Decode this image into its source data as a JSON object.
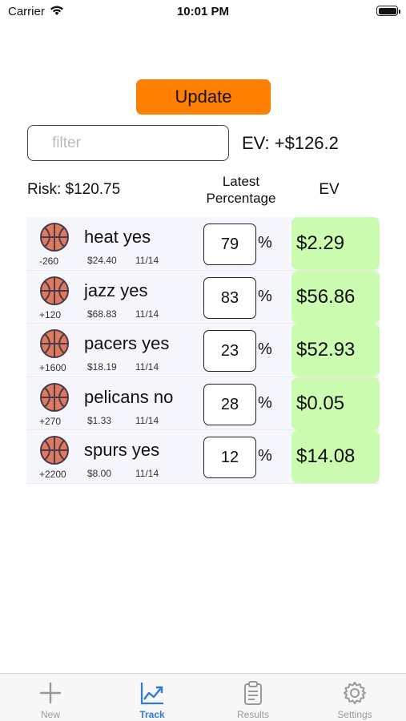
{
  "status_bar": {
    "carrier": "Carrier",
    "time": "10:01 PM"
  },
  "update_label": "Update",
  "filter": {
    "placeholder": "filter",
    "value": ""
  },
  "ev_total": "EV: +$126.2",
  "risk": "Risk: $120.75",
  "columns": {
    "latest_line1": "Latest",
    "latest_line2": "Percentage",
    "ev": "EV"
  },
  "percent_sign": "%",
  "bets": [
    {
      "name": "heat yes",
      "odds": "-260",
      "stake": "$24.40",
      "date": "11/14",
      "percentage": "79",
      "ev": "$2.29"
    },
    {
      "name": "jazz yes",
      "odds": "+120",
      "stake": "$68.83",
      "date": "11/14",
      "percentage": "83",
      "ev": "$56.86"
    },
    {
      "name": "pacers yes",
      "odds": "+1600",
      "stake": "$18.19",
      "date": "11/14",
      "percentage": "23",
      "ev": "$52.93"
    },
    {
      "name": "pelicans no",
      "odds": "+270",
      "stake": "$1.33",
      "date": "11/14",
      "percentage": "28",
      "ev": "$0.05"
    },
    {
      "name": "spurs yes",
      "odds": "+2200",
      "stake": "$8.00",
      "date": "11/14",
      "percentage": "12",
      "ev": "$14.08"
    }
  ],
  "tabs": [
    {
      "label": "New",
      "icon": "plus-icon",
      "active": false
    },
    {
      "label": "Track",
      "icon": "chart-line-icon",
      "active": true
    },
    {
      "label": "Results",
      "icon": "clipboard-icon",
      "active": false
    },
    {
      "label": "Settings",
      "icon": "gear-icon",
      "active": false
    }
  ],
  "colors": {
    "accent_orange": "#ff8000",
    "ev_positive_green": "#ccfcb0",
    "row_background": "#f6f6fd",
    "tab_active_blue": "#2f7bd9",
    "tab_inactive_gray": "#999999",
    "basketball": "#e07a5f"
  }
}
